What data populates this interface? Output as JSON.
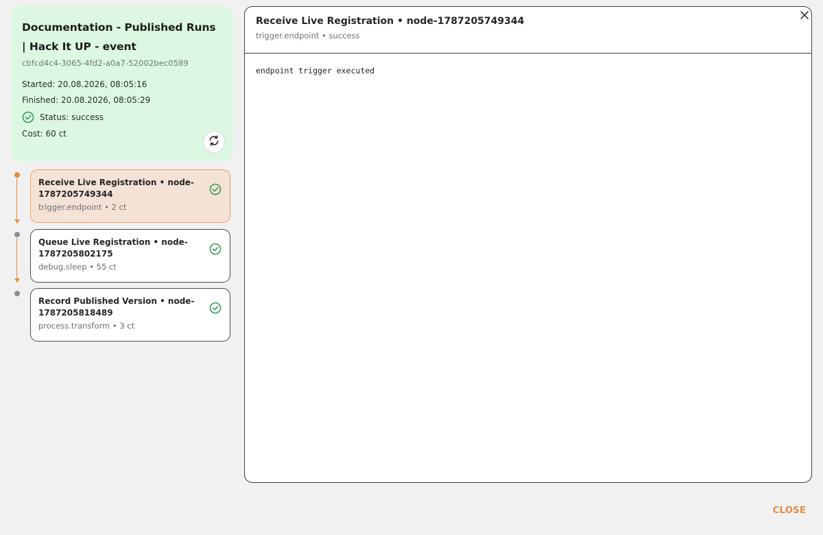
{
  "run": {
    "title": "Documentation - Published Runs | Hack It UP - event",
    "id": "cbfcd4c4-3065-4fd2-a0a7-52002bec0589",
    "started": "Started: 20.08.2026, 08:05:16",
    "finished": "Finished: 20.08.2026, 08:05:29",
    "status": "Status: success",
    "cost": "Cost: 60 ct"
  },
  "nodes": [
    {
      "title": "Receive Live Registration • node-1787205749344",
      "sub": "trigger.endpoint • 2 ct",
      "status": "success",
      "active": true
    },
    {
      "title": "Queue Live Registration • node-1787205802175",
      "sub": "debug.sleep • 55 ct",
      "status": "success",
      "active": false
    },
    {
      "title": "Record Published Version • node-1787205818489",
      "sub": "process.transform • 3 ct",
      "status": "success",
      "active": false
    }
  ],
  "detail": {
    "title": "Receive Live Registration • node-1787205749344",
    "sub": "trigger.endpoint • success",
    "output": "endpoint trigger executed"
  },
  "footer": {
    "close_label": "CLOSE"
  },
  "colors": {
    "accent": "#e88a3c",
    "success": "#2e9a4a",
    "card_bg": "#dcf8e3",
    "active_bg": "#f5e2d6"
  },
  "icons": {
    "refresh": "refresh-icon",
    "close": "close-icon",
    "check": "check-circle-icon"
  }
}
